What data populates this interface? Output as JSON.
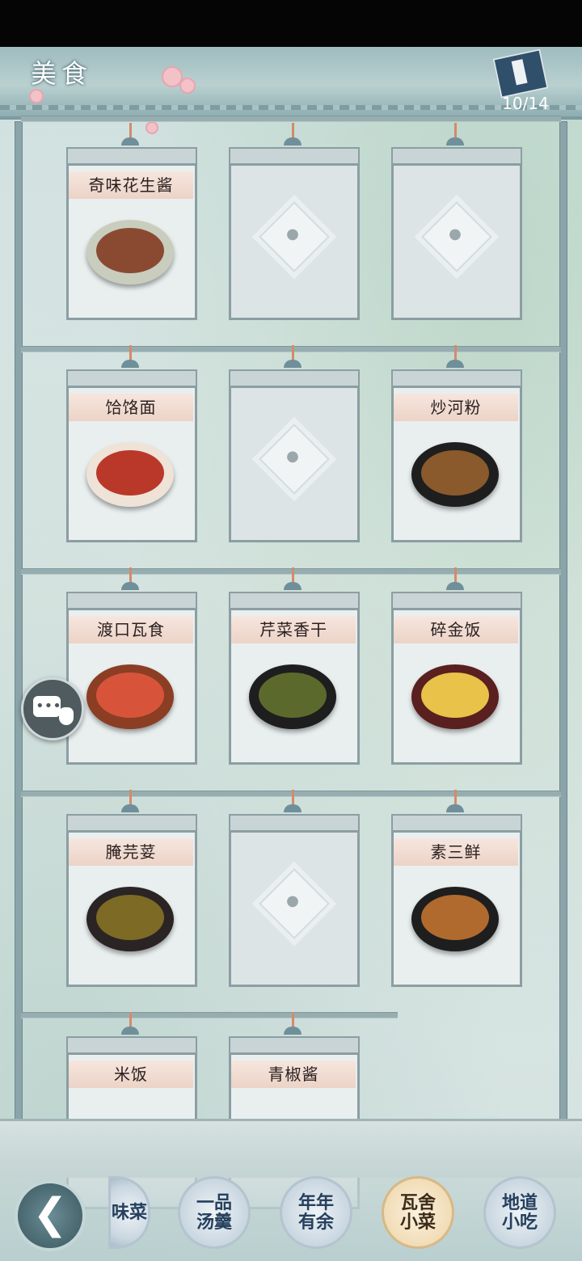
{
  "header": {
    "title": "美食",
    "progress_text": "10/14"
  },
  "cards": [
    {
      "label": "奇味花生酱",
      "unlocked": true
    },
    {
      "label": "",
      "unlocked": false
    },
    {
      "label": "",
      "unlocked": false
    },
    {
      "label": "饸饹面",
      "unlocked": true
    },
    {
      "label": "",
      "unlocked": false
    },
    {
      "label": "炒河粉",
      "unlocked": true
    },
    {
      "label": "渡口瓦食",
      "unlocked": true
    },
    {
      "label": "芹菜香干",
      "unlocked": true
    },
    {
      "label": "碎金饭",
      "unlocked": true
    },
    {
      "label": "腌芫荽",
      "unlocked": true
    },
    {
      "label": "",
      "unlocked": false
    },
    {
      "label": "素三鲜",
      "unlocked": true
    },
    {
      "label": "米饭",
      "unlocked": true
    },
    {
      "label": "青椒酱",
      "unlocked": true
    }
  ],
  "tabs": [
    {
      "label": "味菜",
      "active": false
    },
    {
      "label": "一品汤羹",
      "active": false
    },
    {
      "label": "年年有余",
      "active": false
    },
    {
      "label": "瓦舍小菜",
      "active": true
    },
    {
      "label": "地道小吃",
      "active": false
    }
  ],
  "icons": {
    "back": "back-arrow-icon",
    "chat": "chat-bubble-icon",
    "book": "recipe-book-icon",
    "lock": "lock-icon"
  },
  "colors": {
    "card_label_bg": "#ecd3c7",
    "active_tab": "#f1dcb6",
    "inactive_tab": "#c9d6e0"
  }
}
